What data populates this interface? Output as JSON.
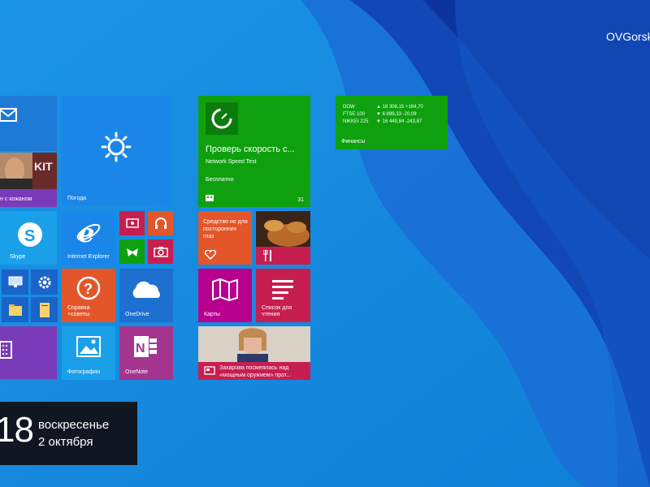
{
  "user": {
    "name": "OVGorsk"
  },
  "tiles": {
    "mail": {
      "label": ""
    },
    "news_person": {
      "label": "н с кожаном"
    },
    "weather": {
      "label": "Погода"
    },
    "skype": {
      "label": "Skype"
    },
    "ie": {
      "label": "Internet Explorer"
    },
    "help": {
      "label": "Справка\n+советы"
    },
    "onedrive": {
      "label": "OneDrive"
    },
    "photos": {
      "label": "Фотографии"
    },
    "onenote": {
      "label": "OneNote"
    },
    "speedtest": {
      "title": "Проверь скорость с...",
      "subtitle": "Network Speed Test",
      "price": "Бесплатно",
      "count": "31"
    },
    "health": {
      "label": "Средство не для\nпосторонних\nглаз"
    },
    "maps": {
      "label": "Карты"
    },
    "reading": {
      "label": "Список для\nчтения"
    },
    "news": {
      "headline": "Захарова посмеялась над\n«мощным оружием» прот..."
    },
    "finance": {
      "label": "Финансы",
      "rows": [
        {
          "name": "DOW",
          "value": "▲ 18 308,15 +164,70"
        },
        {
          "name": "FTSE 100",
          "value": "▼ 6 899,33 -20,09"
        },
        {
          "name": "NIKKEI 225",
          "value": "▼ 16 449,84 -243,87"
        }
      ]
    }
  },
  "clock": {
    "time": "18",
    "day": "воскресенье",
    "date": "2 октября"
  },
  "colors": {
    "background": "#1b8fe0",
    "green": "#0ea00e",
    "orange": "#e3562a",
    "purple": "#7a3bb9",
    "magenta": "#b7008e",
    "crimson": "#c71e50",
    "blue_tile": "#1d7ad6",
    "dark_blue": "#1a63c8"
  }
}
